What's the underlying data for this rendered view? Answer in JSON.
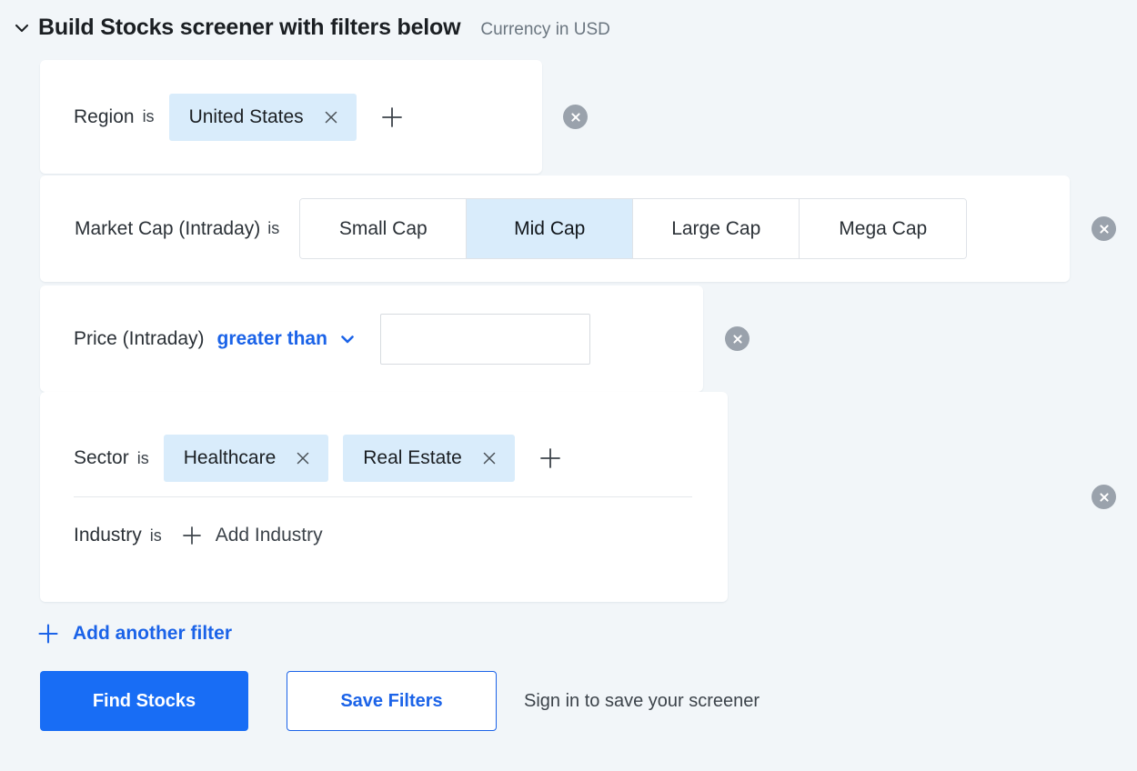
{
  "header": {
    "toggle_icon": "chevron-down-icon",
    "title": "Build Stocks screener with filters below",
    "currency_note": "Currency in USD"
  },
  "filters": [
    {
      "id": "region",
      "label": "Region",
      "operator": "is",
      "tags": [
        {
          "label": "United States",
          "remove_icon": "close-icon"
        }
      ],
      "add_icon": "plus-icon",
      "remove_filter_icon": "remove-circle-icon"
    },
    {
      "id": "market-cap",
      "label": "Market Cap (Intraday)",
      "operator": "is",
      "options": [
        {
          "label": "Small Cap",
          "selected": false
        },
        {
          "label": "Mid Cap",
          "selected": true
        },
        {
          "label": "Large Cap",
          "selected": false
        },
        {
          "label": "Mega Cap",
          "selected": false
        }
      ],
      "remove_filter_icon": "remove-circle-icon"
    },
    {
      "id": "price",
      "label": "Price (Intraday)",
      "operator_selected": "greater than",
      "operator_caret_icon": "chevron-down-icon",
      "value": "",
      "value_placeholder": "",
      "remove_filter_icon": "remove-circle-icon"
    },
    {
      "id": "sector",
      "label": "Sector",
      "operator": "is",
      "tags": [
        {
          "label": "Healthcare",
          "remove_icon": "close-icon"
        },
        {
          "label": "Real Estate",
          "remove_icon": "close-icon"
        }
      ],
      "add_icon": "plus-icon",
      "sub": {
        "label": "Industry",
        "operator": "is",
        "add_icon": "plus-icon",
        "add_label": "Add Industry"
      },
      "remove_filter_icon": "remove-circle-icon"
    }
  ],
  "add_another_filter": {
    "icon": "plus-icon",
    "label": "Add another filter"
  },
  "actions": {
    "find_stocks": "Find Stocks",
    "save_filters": "Save Filters",
    "signin_note": "Sign in to save your screener"
  },
  "colors": {
    "page_background": "#f2f6f9",
    "accent_blue": "#1b63e8",
    "primary_button": "#186df5",
    "tag_background": "#d9ecfb",
    "selected_segment": "#d9ecfb",
    "remove_circle": "#9aa2ac",
    "card_background": "#ffffff"
  }
}
